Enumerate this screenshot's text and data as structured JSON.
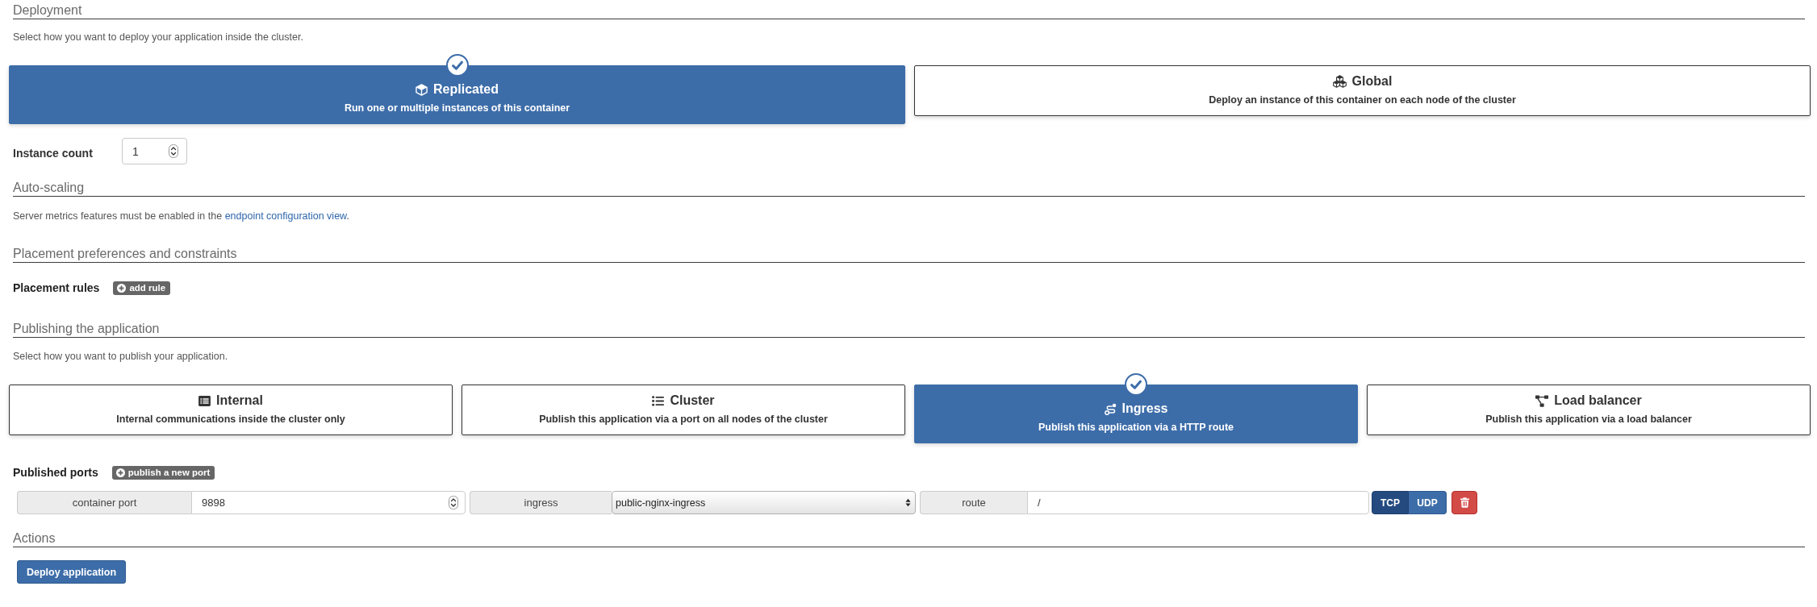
{
  "deployment": {
    "title": "Deployment",
    "description": "Select how you want to deploy your application inside the cluster.",
    "modes": [
      {
        "title": "Replicated",
        "description": "Run one or multiple instances of this container",
        "selected": true
      },
      {
        "title": "Global",
        "description": "Deploy an instance of this container on each node of the cluster",
        "selected": false
      }
    ],
    "instance_count": {
      "label": "Instance count",
      "value": "1"
    }
  },
  "auto_scaling": {
    "title": "Auto-scaling",
    "note_before": "Server metrics features must be enabled in the ",
    "note_link": "endpoint configuration view",
    "note_after": "."
  },
  "placement": {
    "title": "Placement preferences and constraints",
    "rules_label": "Placement rules",
    "add_button": "add rule"
  },
  "publishing": {
    "title": "Publishing the application",
    "description": "Select how you want to publish your application.",
    "modes": [
      {
        "title": "Internal",
        "description": "Internal communications inside the cluster only",
        "selected": false
      },
      {
        "title": "Cluster",
        "description": "Publish this application via a port on all nodes of the cluster",
        "selected": false
      },
      {
        "title": "Ingress",
        "description": "Publish this application via a HTTP route",
        "selected": true
      },
      {
        "title": "Load balancer",
        "description": "Publish this application via a load balancer",
        "selected": false
      }
    ],
    "ports_label": "Published ports",
    "add_button": "publish a new port",
    "ports": [
      {
        "container_port_label": "container port",
        "container_port": "9898",
        "ingress_label": "ingress",
        "ingress": "public-nginx-ingress",
        "route_label": "route",
        "route": "/",
        "protocols": [
          {
            "label": "TCP",
            "selected": true
          },
          {
            "label": "UDP",
            "selected": false
          }
        ]
      }
    ]
  },
  "actions": {
    "title": "Actions",
    "buttons": [
      "Deploy application"
    ]
  }
}
